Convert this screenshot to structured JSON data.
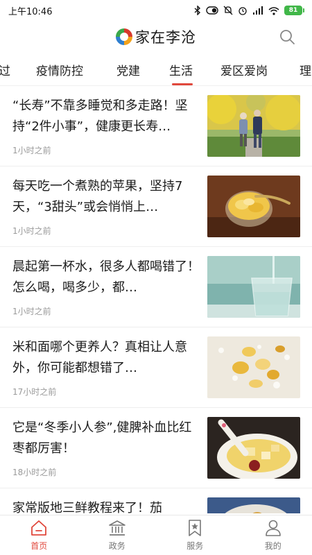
{
  "status_bar": {
    "time": "上午10:46",
    "battery": "81"
  },
  "header": {
    "app_name": "家在李沧",
    "icons": [
      "logo-icon",
      "search-icon"
    ]
  },
  "tabs": [
    {
      "label": "过"
    },
    {
      "label": "疫情防控"
    },
    {
      "label": "党建"
    },
    {
      "label": "生活",
      "active": true
    },
    {
      "label": "爱区爱岗"
    },
    {
      "label": "理"
    }
  ],
  "feed": [
    {
      "title": "“长寿”不靠多睡觉和多走路！坚持“2件小事”，健康更长寿…",
      "time": "1小时之前",
      "thumb": "elderly-couple-walking-image"
    },
    {
      "title": "每天吃一个煮熟的苹果，坚持7天，“3甜头”或会悄悄上…",
      "time": "1小时之前",
      "thumb": "cooked-apple-bowl-image"
    },
    {
      "title": "晨起第一杯水，很多人都喝错了！怎么喝，喝多少，都…",
      "time": "1小时之前",
      "thumb": "glass-of-water-image"
    },
    {
      "title": "米和面哪个更养人？真相让人意外，你可能都想错了…",
      "time": "17小时之前",
      "thumb": "rice-porridge-image"
    },
    {
      "title": "它是“冬季小人参”,健脾补血比红枣都厉害！",
      "time": "18小时之前",
      "thumb": "yam-soup-bowl-image"
    },
    {
      "title": "家常版地三鲜教程来了！茄",
      "time": "",
      "thumb": "vegetable-dish-image"
    }
  ],
  "bottom_nav": [
    {
      "label": "首页",
      "icon": "home-icon",
      "active": true
    },
    {
      "label": "政务",
      "icon": "government-building-icon"
    },
    {
      "label": "服务",
      "icon": "service-bookmark-icon"
    },
    {
      "label": "我的",
      "icon": "profile-icon"
    }
  ],
  "colors": {
    "accent": "#e0483c",
    "text": "#1c1c1c",
    "muted": "#9a9a9a",
    "battery": "#41b749"
  }
}
